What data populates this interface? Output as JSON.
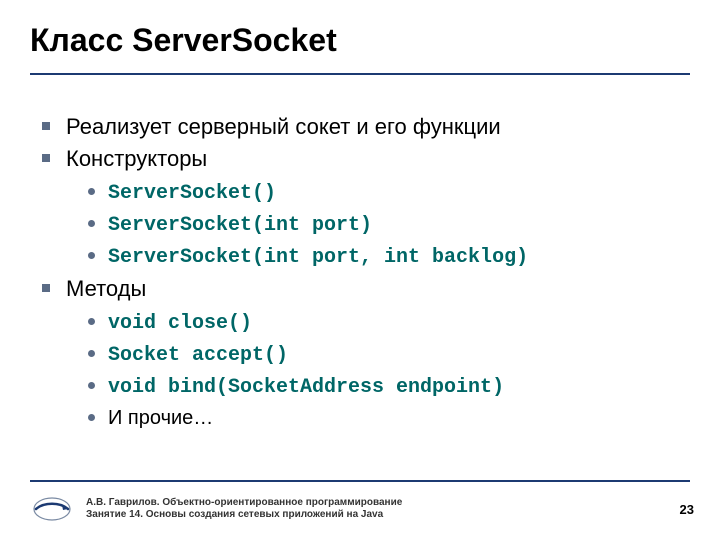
{
  "title": "Класс ServerSocket",
  "bullets": {
    "b1": "Реализует серверный сокет и его функции",
    "b2": "Конструкторы",
    "b2_1": "ServerSocket()",
    "b2_2": "ServerSocket(int port)",
    "b2_3": "ServerSocket(int port, int backlog)",
    "b3": "Методы",
    "b3_1": "void close()",
    "b3_2": "Socket accept()",
    "b3_3": "void bind(SocketAddress endpoint)",
    "b3_4": "И прочие…"
  },
  "footer": {
    "line1": "А.В. Гаврилов. Объектно-ориентированное программирование",
    "line2": "Занятие 14. Основы создания сетевых приложений на Java"
  },
  "page": "23"
}
